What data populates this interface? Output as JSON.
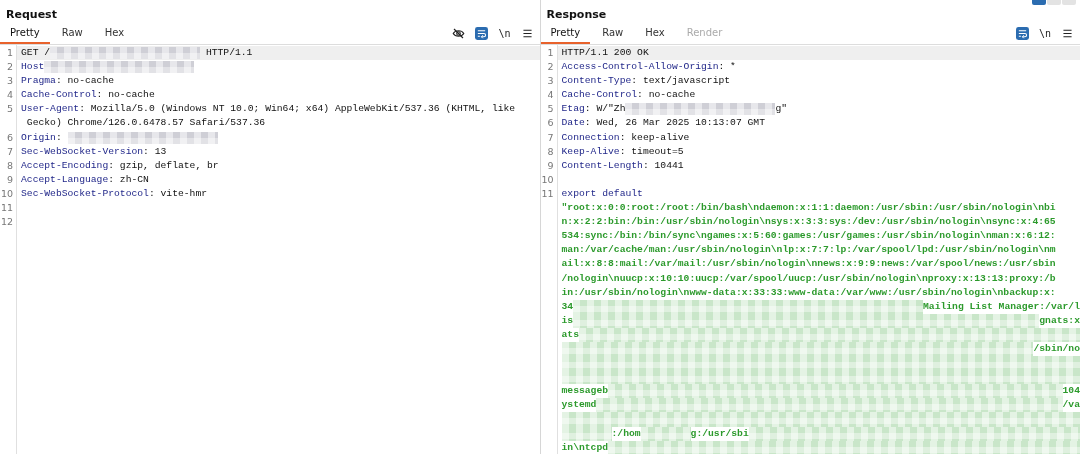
{
  "panes": [
    {
      "title": "Request",
      "tabs": [
        {
          "label": "Pretty",
          "selected": true,
          "disabled": false
        },
        {
          "label": "Raw",
          "selected": false,
          "disabled": false
        },
        {
          "label": "Hex",
          "selected": false,
          "disabled": false
        }
      ],
      "tools": [
        {
          "kind": "hide"
        },
        {
          "kind": "wrap",
          "on": true
        },
        {
          "kind": "text",
          "label": "\\n"
        },
        {
          "kind": "menu"
        }
      ],
      "lines": [
        {
          "number": "1",
          "highlighted": true,
          "segments": [
            {
              "kind": "value",
              "text": "GET /"
            },
            {
              "kind": "redacted"
            },
            {
              "kind": "value",
              "text": " HTTP/1.1"
            }
          ]
        },
        {
          "number": "2",
          "highlighted": false,
          "segments": [
            {
              "kind": "key",
              "text": "Host"
            },
            {
              "kind": "redacted"
            }
          ]
        },
        {
          "number": "3",
          "highlighted": false,
          "segments": [
            {
              "kind": "key",
              "text": "Pragma"
            },
            {
              "kind": "value",
              "text": ": no-cache"
            }
          ]
        },
        {
          "number": "4",
          "highlighted": false,
          "segments": [
            {
              "kind": "key",
              "text": "Cache-Control"
            },
            {
              "kind": "value",
              "text": ": no-cache"
            }
          ]
        },
        {
          "number": "5",
          "highlighted": false,
          "segments": [
            {
              "kind": "key",
              "text": "User-Agent"
            },
            {
              "kind": "value",
              "text": ": Mozilla/5.0 (Windows NT 10.0; Win64; x64) AppleWebKit/537.36 (KHTML, like"
            }
          ]
        },
        {
          "highlighted": false,
          "segments": [
            {
              "kind": "value",
              "text": " Gecko) Chrome/126.0.6478.57 Safari/537.36"
            }
          ]
        },
        {
          "number": "6",
          "highlighted": false,
          "segments": [
            {
              "kind": "key",
              "text": "Origin"
            },
            {
              "kind": "value",
              "text": ": "
            },
            {
              "kind": "redacted"
            }
          ]
        },
        {
          "number": "7",
          "highlighted": false,
          "segments": [
            {
              "kind": "key",
              "text": "Sec-WebSocket-Version"
            },
            {
              "kind": "value",
              "text": ": 13"
            }
          ]
        },
        {
          "number": "8",
          "highlighted": false,
          "segments": [
            {
              "kind": "key",
              "text": "Accept-Encoding"
            },
            {
              "kind": "value",
              "text": ": gzip, deflate, br"
            }
          ]
        },
        {
          "number": "9",
          "highlighted": false,
          "segments": [
            {
              "kind": "key",
              "text": "Accept-Language"
            },
            {
              "kind": "value",
              "text": ": zh-CN"
            }
          ]
        },
        {
          "number": "10",
          "highlighted": false,
          "segments": [
            {
              "kind": "key",
              "text": "Sec-WebSocket-Protocol"
            },
            {
              "kind": "value",
              "text": ": vite-hmr"
            }
          ]
        },
        {
          "number": "11",
          "highlighted": false
        },
        {
          "number": "12",
          "highlighted": false
        }
      ]
    },
    {
      "title": "Response",
      "tabs": [
        {
          "label": "Pretty",
          "selected": true,
          "disabled": false
        },
        {
          "label": "Raw",
          "selected": false,
          "disabled": false
        },
        {
          "label": "Hex",
          "selected": false,
          "disabled": false
        },
        {
          "label": "Render",
          "selected": false,
          "disabled": true
        }
      ],
      "tools": [
        {
          "kind": "wrap",
          "on": true
        },
        {
          "kind": "text",
          "label": "\\n"
        },
        {
          "kind": "menu"
        }
      ],
      "lines": [
        {
          "number": "1",
          "highlighted": true,
          "segments": [
            {
              "kind": "value",
              "text": "HTTP/1.1 200 OK"
            }
          ]
        },
        {
          "number": "2",
          "highlighted": false,
          "segments": [
            {
              "kind": "key",
              "text": "Access-Control-Allow-Origin"
            },
            {
              "kind": "value",
              "text": ": *"
            }
          ]
        },
        {
          "number": "3",
          "highlighted": false,
          "segments": [
            {
              "kind": "key",
              "text": "Content-Type"
            },
            {
              "kind": "value",
              "text": ": text/javascript"
            }
          ]
        },
        {
          "number": "4",
          "highlighted": false,
          "segments": [
            {
              "kind": "key",
              "text": "Cache-Control"
            },
            {
              "kind": "value",
              "text": ": no-cache"
            }
          ]
        },
        {
          "number": "5",
          "highlighted": false,
          "segments": [
            {
              "kind": "key",
              "text": "Etag"
            },
            {
              "kind": "value",
              "text": ": W/\"Zh"
            },
            {
              "kind": "redacted"
            },
            {
              "kind": "value",
              "text": "g\""
            }
          ]
        },
        {
          "number": "6",
          "highlighted": false,
          "segments": [
            {
              "kind": "key",
              "text": "Date"
            },
            {
              "kind": "value",
              "text": ": Wed, 26 Mar 2025 10:13:07 GMT"
            }
          ]
        },
        {
          "number": "7",
          "highlighted": false,
          "segments": [
            {
              "kind": "key",
              "text": "Connection"
            },
            {
              "kind": "value",
              "text": ": keep-alive"
            }
          ]
        },
        {
          "number": "8",
          "highlighted": false,
          "segments": [
            {
              "kind": "key",
              "text": "Keep-Alive"
            },
            {
              "kind": "value",
              "text": ": timeout=5"
            }
          ]
        },
        {
          "number": "9",
          "highlighted": false,
          "segments": [
            {
              "kind": "key",
              "text": "Content-Length"
            },
            {
              "kind": "value",
              "text": ": 10441"
            }
          ]
        },
        {
          "number": "10",
          "highlighted": false
        },
        {
          "number": "11",
          "highlighted": false,
          "segments": [
            {
              "kind": "key",
              "text": "export default"
            }
          ]
        },
        {
          "highlighted": false,
          "segments": [
            {
              "kind": "string",
              "text": "\"root:x:0:0:root:/root:/bin/bash\\ndaemon:x:1:1:daemon:/usr/sbin:/usr/sbin/nologin\\nbi"
            }
          ]
        },
        {
          "highlighted": false,
          "segments": [
            {
              "kind": "string",
              "text": "n:x:2:2:bin:/bin:/usr/sbin/nologin\\nsys:x:3:3:sys:/dev:/usr/sbin/nologin\\nsync:x:4:65"
            }
          ]
        },
        {
          "highlighted": false,
          "segments": [
            {
              "kind": "string",
              "text": "534:sync:/bin:/bin/sync\\ngames:x:5:60:games:/usr/games:/usr/sbin/nologin\\nman:x:6:12:"
            }
          ]
        },
        {
          "highlighted": false,
          "segments": [
            {
              "kind": "string",
              "text": "man:/var/cache/man:/usr/sbin/nologin\\nlp:x:7:7:lp:/var/spool/lpd:/usr/sbin/nologin\\nm"
            }
          ]
        },
        {
          "highlighted": false,
          "segments": [
            {
              "kind": "string",
              "text": "ail:x:8:8:mail:/var/mail:/usr/sbin/nologin\\nnews:x:9:9:news:/var/spool/news:/usr/sbin"
            }
          ]
        },
        {
          "highlighted": false,
          "segments": [
            {
              "kind": "string",
              "text": "/nologin\\nuucp:x:10:10:uucp:/var/spool/uucp:/usr/sbin/nologin\\nproxy:x:13:13:proxy:/b"
            }
          ]
        },
        {
          "highlighted": false,
          "segments": [
            {
              "kind": "string",
              "text": "in:/usr/sbin/nologin\\nwww-data:x:33:33:www-data:/var/www:/usr/sbin/nologin\\nbackup:x:"
            }
          ]
        },
        {
          "highlighted": false,
          "segments": [
            {
              "kind": "string",
              "text": "34"
            },
            {
              "kind": "redacted"
            },
            {
              "kind": "string",
              "text": "Mailing List Manager:/var/l"
            }
          ]
        },
        {
          "highlighted": false,
          "segments": [
            {
              "kind": "string",
              "text": "is"
            },
            {
              "kind": "redacted"
            },
            {
              "kind": "string",
              "text": "gnats:x"
            }
          ]
        },
        {
          "highlighted": false,
          "segments": [
            {
              "kind": "string",
              "text": "ats"
            },
            {
              "kind": "redacted"
            }
          ]
        },
        {
          "highlighted": false,
          "segments": [
            {
              "kind": "redacted"
            },
            {
              "kind": "string",
              "text": "/sbin/no"
            }
          ]
        },
        {
          "highlighted": false,
          "segments": [
            {
              "kind": "redacted"
            }
          ]
        },
        {
          "highlighted": false,
          "segments": [
            {
              "kind": "redacted"
            }
          ]
        },
        {
          "highlighted": false,
          "segments": [
            {
              "kind": "string",
              "text": "messageb"
            },
            {
              "kind": "redacted"
            },
            {
              "kind": "string",
              "text": "104"
            }
          ]
        },
        {
          "highlighted": false,
          "segments": [
            {
              "kind": "string",
              "text": "ystemd"
            },
            {
              "kind": "redacted"
            },
            {
              "kind": "string",
              "text": "/va"
            }
          ]
        },
        {
          "highlighted": false,
          "segments": [
            {
              "kind": "redacted"
            }
          ]
        },
        {
          "highlighted": false,
          "segments": [
            {
              "kind": "redacted"
            },
            {
              "kind": "string",
              "text": ":/hom"
            },
            {
              "kind": "redacted"
            },
            {
              "kind": "string",
              "text": "g:/usr/sbi"
            },
            {
              "kind": "redacted"
            }
          ]
        },
        {
          "highlighted": false,
          "segments": [
            {
              "kind": "string",
              "text": "in\\ntcpd"
            },
            {
              "kind": "redacted"
            }
          ]
        }
      ]
    }
  ]
}
